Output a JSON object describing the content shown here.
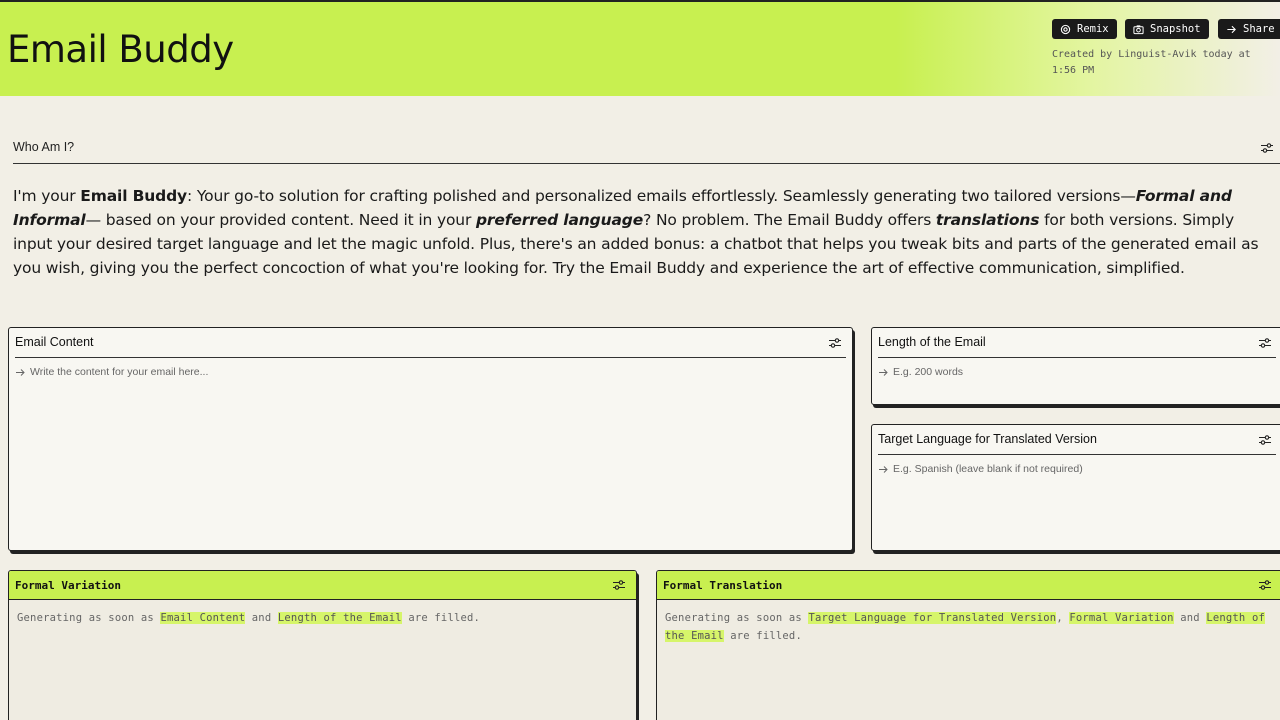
{
  "app": {
    "title": "Email Buddy"
  },
  "header": {
    "buttons": [
      {
        "label": "Remix",
        "icon": "remix-icon"
      },
      {
        "label": "Snapshot",
        "icon": "camera-icon"
      },
      {
        "label": "Share",
        "icon": "arrow-right-icon"
      }
    ],
    "created_line1": "Created by Linguist-Avik today at",
    "created_line2": "1:56 PM"
  },
  "about": {
    "heading": "Who Am I?",
    "p1": "I'm your ",
    "b1": "Email Buddy",
    "p2": ": Your go-to solution for crafting polished and personalized emails effortlessly. Seamlessly generating two tailored versions—",
    "bi1": "Formal and Informal",
    "p3": "— based on your provided content. Need it in your ",
    "bi2": "preferred language",
    "p4": "? No problem. The Email Buddy offers ",
    "bi3": "translations",
    "p5": " for both versions. Simply input your desired target language and let the magic unfold. Plus, there's an added bonus: a chatbot that helps you tweak bits and parts of the generated email as you wish, giving you the perfect concoction of what you're looking for. Try the Email Buddy and experience the art of effective communication, simplified."
  },
  "inputs": {
    "email_content": {
      "label": "Email Content",
      "placeholder": "Write the content for your email here..."
    },
    "length": {
      "label": "Length of the Email",
      "placeholder": "E.g. 200 words"
    },
    "target_language": {
      "label": "Target Language for Translated Version",
      "placeholder": "E.g. Spanish (leave blank if not required)"
    }
  },
  "outputs": {
    "formal": {
      "title": "Formal Variation",
      "t1": "Generating as soon as ",
      "h1": "Email Content",
      "t2": " and ",
      "h2": "Length of the Email",
      "t3": " are filled."
    },
    "translation": {
      "title": "Formal Translation",
      "t1": "Generating as soon as ",
      "h1": "Target Language for Translated Version",
      "t2": ", ",
      "h2": "Formal Variation",
      "t3": " and ",
      "h3": "Length of the Email",
      "t4": " are filled."
    }
  },
  "colors": {
    "accent": "#c8f050",
    "background": "#f2efe6",
    "ink": "#1a1a1a"
  }
}
